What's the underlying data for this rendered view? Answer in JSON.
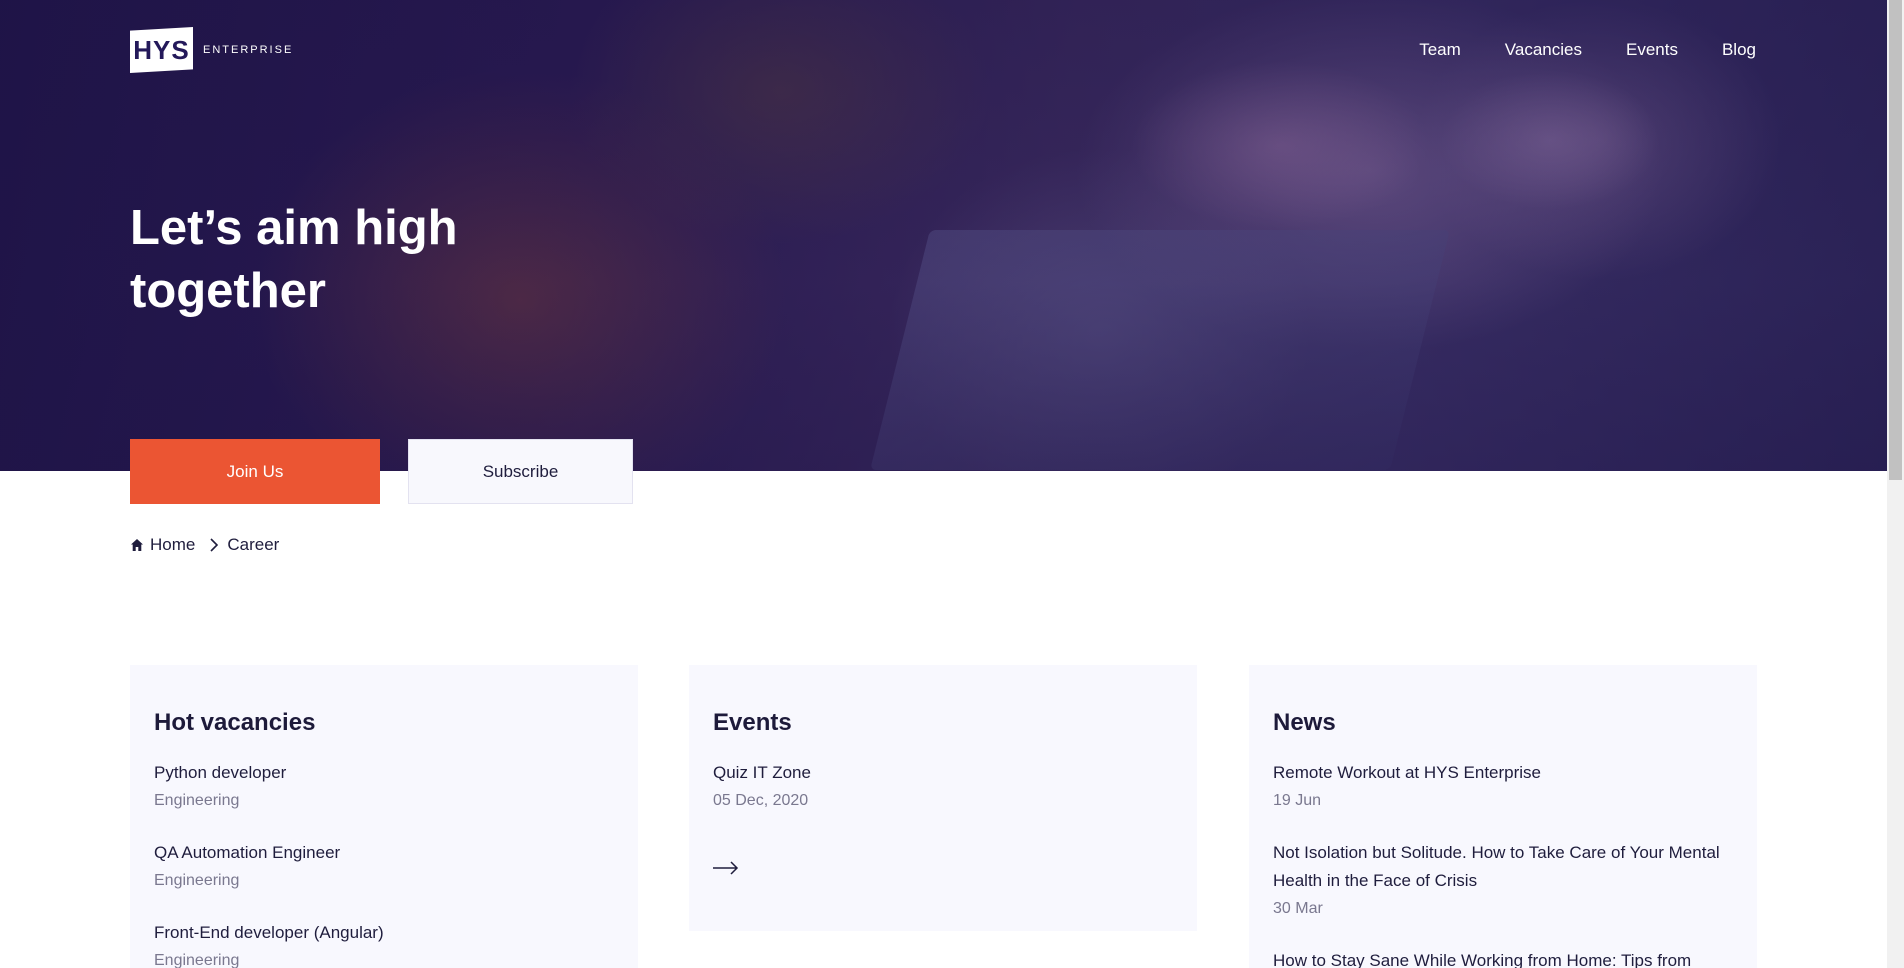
{
  "brand": {
    "mark": "HYS",
    "name": "ENTERPRISE"
  },
  "nav": {
    "items": [
      {
        "label": "Team"
      },
      {
        "label": "Vacancies"
      },
      {
        "label": "Events"
      },
      {
        "label": "Blog"
      }
    ]
  },
  "hero": {
    "title": "Let’s aim high together",
    "join_label": "Join Us",
    "subscribe_label": "Subscribe"
  },
  "breadcrumb": {
    "home": "Home",
    "current": "Career"
  },
  "vacancies": {
    "heading": "Hot vacancies",
    "items": [
      {
        "title": "Python developer",
        "category": "Engineering"
      },
      {
        "title": "QA Automation Engineer",
        "category": "Engineering"
      },
      {
        "title": "Front-End developer (Angular)",
        "category": "Engineering"
      }
    ]
  },
  "events": {
    "heading": "Events",
    "items": [
      {
        "title": "Quiz IT Zone",
        "date": "05 Dec, 2020"
      }
    ]
  },
  "news": {
    "heading": "News",
    "items": [
      {
        "title": "Remote Workout at HYS Enterprise",
        "date": "19 Jun"
      },
      {
        "title": "Not Isolation but Solitude. How to Take Care of Your Mental Health in the Face of Crisis",
        "date": "30 Mar"
      },
      {
        "title": "How to Stay Sane While Working from Home: Tips from Team"
      }
    ]
  },
  "colors": {
    "accent": "#eb5533",
    "hero_overlay": "#24195a",
    "card_bg": "#f8f8fe"
  }
}
